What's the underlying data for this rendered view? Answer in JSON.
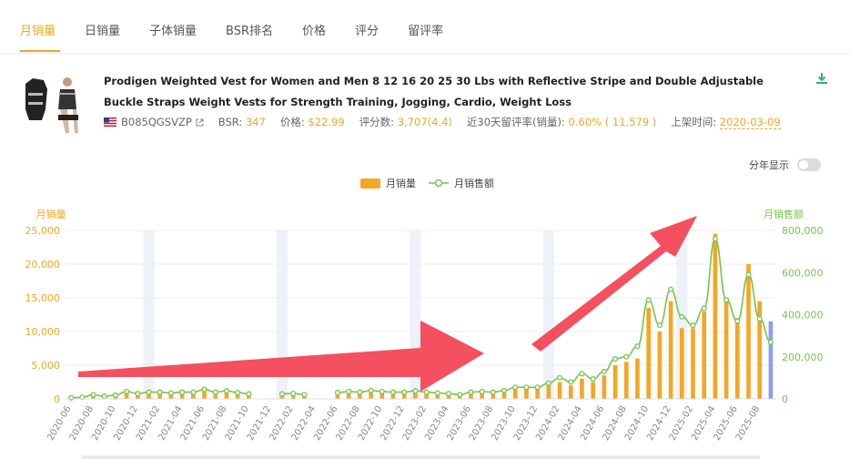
{
  "tabs": [
    {
      "label": "月销量",
      "active": true
    },
    {
      "label": "日销量",
      "active": false
    },
    {
      "label": "子体销量",
      "active": false
    },
    {
      "label": "BSR排名",
      "active": false
    },
    {
      "label": "价格",
      "active": false
    },
    {
      "label": "评分",
      "active": false
    },
    {
      "label": "留评率",
      "active": false
    }
  ],
  "product": {
    "title": "Prodigen Weighted Vest for Women and Men 8 12 16 20 25 30 Lbs with Reflective Stripe and Double Adjustable Buckle Straps Weight Vests for Strength Training, Jogging, Cardio, Weight Loss",
    "asin": "B085QGSVZP",
    "bsr_label": "BSR:",
    "bsr_value": "347",
    "price_label": "价格:",
    "price_value": "$22.99",
    "reviews_label": "评分数:",
    "reviews_value": "3,707(4.4)",
    "review_rate_label": "近30天留评率(销量):",
    "review_rate_value": "0.60% ( 11,579 )",
    "listed_label": "上架时间:",
    "listed_value": "2020-03-09"
  },
  "controls": {
    "year_toggle_label": "分年显示",
    "year_toggle_on": false
  },
  "legend": {
    "bar_label": "月销量",
    "line_label": "月销售额"
  },
  "colors": {
    "accent": "#f5a623",
    "bar": "#f5a623",
    "bar_latest": "#8e9cf5",
    "line": "#72c84d",
    "arrow": "#f4505f"
  },
  "chart_data": {
    "type": "bar+line",
    "left_axis_title": "月销量",
    "right_axis_title": "月销售额",
    "left_ticks": [
      "25,000",
      "20,000",
      "15,000",
      "10,000",
      "5,000",
      "0"
    ],
    "right_ticks": [
      "800,000",
      "600,000",
      "400,000",
      "200,000",
      "0"
    ],
    "ylim_left": [
      0,
      25000
    ],
    "ylim_right": [
      0,
      800000
    ],
    "x_tick_labels": [
      "2020-06",
      "2020-08",
      "2020-10",
      "2020-12",
      "2021-02",
      "2021-04",
      "2021-06",
      "2021-08",
      "2021-10",
      "2021-12",
      "2022-02",
      "2022-04",
      "2022-06",
      "2022-08",
      "2022-10",
      "2022-12",
      "2023-02",
      "2023-04",
      "2023-06",
      "2023-08",
      "2023-10",
      "2023-12",
      "2024-02",
      "2024-04",
      "2024-06",
      "2024-08",
      "2024-10",
      "2024-12",
      "2025-02",
      "2025-04",
      "2025-06",
      "2025-08"
    ],
    "months": [
      "2020-06",
      "2020-07",
      "2020-08",
      "2020-09",
      "2020-10",
      "2020-11",
      "2020-12",
      "2021-01",
      "2021-02",
      "2021-03",
      "2021-04",
      "2021-05",
      "2021-06",
      "2021-07",
      "2021-08",
      "2021-09",
      "2021-10",
      "2021-11",
      "2021-12",
      "2022-01",
      "2022-02",
      "2022-03",
      "2022-04",
      "2022-05",
      "2022-06",
      "2022-07",
      "2022-08",
      "2022-09",
      "2022-10",
      "2022-11",
      "2022-12",
      "2023-01",
      "2023-02",
      "2023-03",
      "2023-04",
      "2023-05",
      "2023-06",
      "2023-07",
      "2023-08",
      "2023-09",
      "2023-10",
      "2023-11",
      "2023-12",
      "2024-01",
      "2024-02",
      "2024-03",
      "2024-04",
      "2024-05",
      "2024-06",
      "2024-07",
      "2024-08",
      "2024-09",
      "2024-10",
      "2024-11",
      "2024-12",
      "2025-01",
      "2025-02",
      "2025-03",
      "2025-04",
      "2025-05",
      "2025-06",
      "2025-07",
      "2025-08",
      "2025-09"
    ],
    "monthly_sales": [
      100,
      200,
      500,
      300,
      500,
      1000,
      800,
      1000,
      1000,
      900,
      1000,
      1000,
      1500,
      1100,
      1300,
      1000,
      800,
      null,
      null,
      800,
      900,
      700,
      null,
      null,
      900,
      1100,
      1000,
      1300,
      1100,
      1000,
      1000,
      1200,
      1000,
      900,
      800,
      600,
      1000,
      1100,
      1000,
      1300,
      1700,
      1700,
      1700,
      2000,
      2500,
      2000,
      3000,
      2500,
      3500,
      5000,
      5500,
      6000,
      13500,
      10000,
      14500,
      10500,
      10500,
      13000,
      24500,
      14500,
      12000,
      20000,
      14500,
      11500
    ],
    "monthly_revenue": [
      5000,
      8000,
      20000,
      12000,
      18000,
      35000,
      25000,
      32000,
      32000,
      28000,
      32000,
      32000,
      45000,
      32000,
      38000,
      30000,
      24000,
      null,
      null,
      24000,
      26000,
      20000,
      null,
      null,
      30000,
      35000,
      32000,
      40000,
      35000,
      32000,
      32000,
      38000,
      32000,
      28000,
      25000,
      20000,
      32000,
      35000,
      32000,
      40000,
      55000,
      55000,
      55000,
      75000,
      100000,
      80000,
      120000,
      95000,
      130000,
      190000,
      200000,
      250000,
      470000,
      350000,
      520000,
      390000,
      350000,
      430000,
      760000,
      470000,
      370000,
      590000,
      380000,
      270000
    ],
    "highlight_bands": [
      "2021-01",
      "2022-01",
      "2023-01",
      "2024-01",
      "2025-01"
    ]
  }
}
